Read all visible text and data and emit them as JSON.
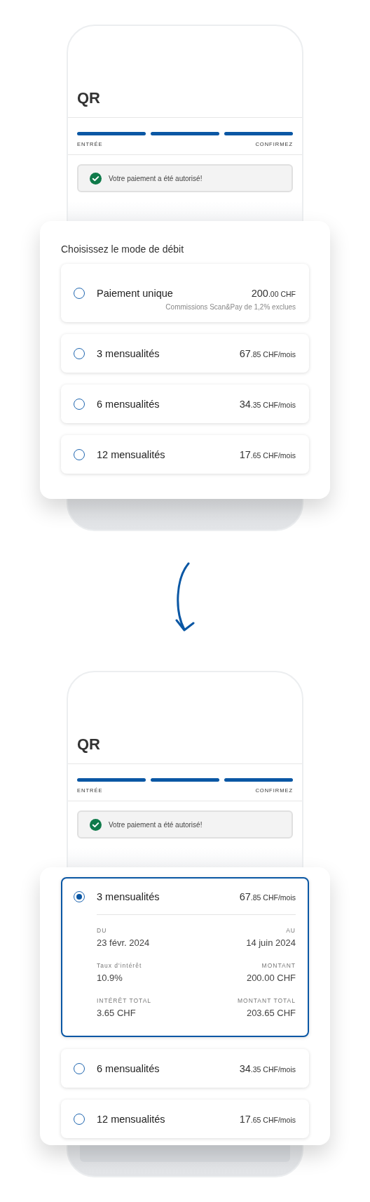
{
  "screens": [
    {
      "title": "QR",
      "steps": [
        {
          "label": "ENTRÉE",
          "done": true
        },
        {
          "done": true
        },
        {
          "label": "CONFIRMEZ",
          "done": true
        }
      ],
      "alert": {
        "text": "Votre paiement a été autorisé!"
      },
      "sheet": {
        "title": "Choisissez le mode de débit",
        "options": [
          {
            "label": "Paiement unique",
            "amount": "200",
            "amount_suffix": ".00 CHF",
            "note": "Commissions Scan&Pay de 1,2% exclues",
            "selected": false
          },
          {
            "label": "3 mensualités",
            "amount": "67",
            "amount_suffix": ".85 CHF/mois",
            "selected": false
          },
          {
            "label": "6 mensualités",
            "amount": "34",
            "amount_suffix": ".35 CHF/mois",
            "selected": false
          },
          {
            "label": "12 mensualités",
            "amount": "17",
            "amount_suffix": ".65 CHF/mois",
            "selected": false
          }
        ]
      }
    },
    {
      "title": "QR",
      "steps": [
        {
          "label": "ENTRÉE",
          "done": true
        },
        {
          "done": true
        },
        {
          "label": "CONFIRMEZ",
          "done": true
        }
      ],
      "alert": {
        "text": "Votre paiement a été autorisé!"
      },
      "behind_card": true,
      "sheet": {
        "options": [
          {
            "label": "3 mensualités",
            "amount": "67",
            "amount_suffix": ".85 CHF/mois",
            "selected": true,
            "details": [
              {
                "label": "DU",
                "value": "23 févr. 2024"
              },
              {
                "label": "AU",
                "value": "14 juin 2024"
              },
              {
                "label": "Taux d'intérêt",
                "value": "10.9%"
              },
              {
                "label": "MONTANT",
                "value": "200.00 CHF"
              },
              {
                "label": "INTÉRÊT TOTAL",
                "value": "3.65 CHF"
              },
              {
                "label": "MONTANT TOTAL",
                "value": "203.65 CHF"
              }
            ]
          },
          {
            "label": "6 mensualités",
            "amount": "34",
            "amount_suffix": ".35 CHF/mois",
            "selected": false
          },
          {
            "label": "12 mensualités",
            "amount": "17",
            "amount_suffix": ".65 CHF/mois",
            "selected": false
          }
        ]
      }
    }
  ]
}
